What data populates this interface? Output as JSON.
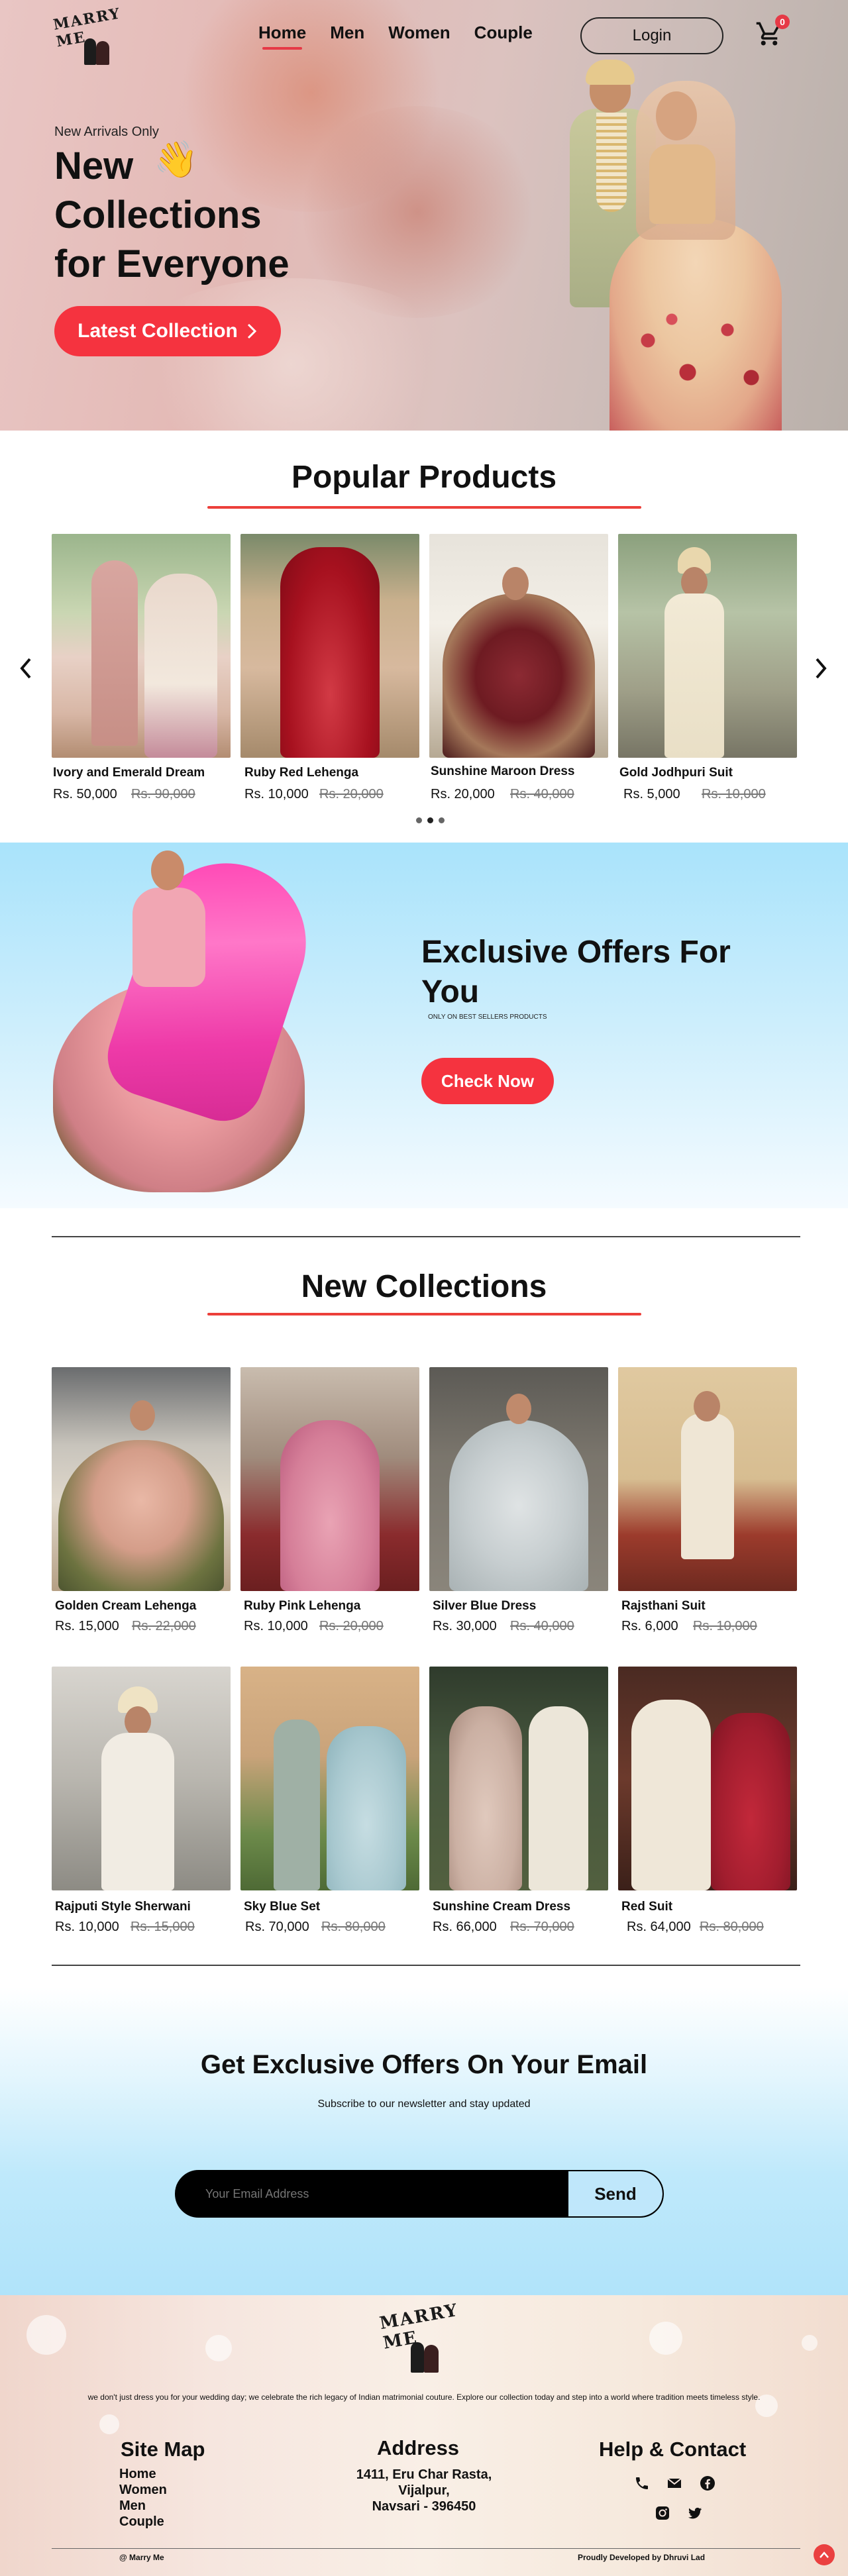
{
  "brand": {
    "logo_text": "MARRY ME"
  },
  "nav": {
    "items": [
      {
        "label": "Home",
        "active": true
      },
      {
        "label": "Men",
        "active": false
      },
      {
        "label": "Women",
        "active": false
      },
      {
        "label": "Couple",
        "active": false
      }
    ],
    "login_label": "Login",
    "cart_count": "0",
    "cart_icon": "cart-icon"
  },
  "hero": {
    "kicker": "New Arrivals Only",
    "title_line1": "New",
    "title_line2": "Collections",
    "title_line3": "for Everyone",
    "wave_icon": "👋",
    "cta_label": "Latest Collection",
    "cta_icon": "chevron-right-icon"
  },
  "popular": {
    "title": "Popular Products",
    "items": [
      {
        "name": "Ivory and Emerald Dream",
        "price": "Rs. 50,000",
        "old_price": "Rs. 90,000"
      },
      {
        "name": "Ruby Red Lehenga",
        "price": "Rs. 10,000",
        "old_price": "Rs. 20,000"
      },
      {
        "name": "Sunshine Maroon Dress",
        "price": "Rs. 20,000",
        "old_price": "Rs. 40,000"
      },
      {
        "name": "Gold Jodhpuri Suit",
        "price": "Rs. 5,000",
        "old_price": "Rs. 10,000"
      }
    ],
    "prev_icon": "chevron-left-icon",
    "next_icon": "chevron-right-icon",
    "dots": 3,
    "active_dot": 2
  },
  "offers": {
    "title": "Exclusive Offers For You",
    "subtitle": "ONLY ON BEST SELLERS PRODUCTS",
    "cta_label": "Check Now"
  },
  "new_collections": {
    "title": "New Collections",
    "items": [
      {
        "name": "Golden Cream Lehenga",
        "price": "Rs. 15,000",
        "old_price": "Rs. 22,000"
      },
      {
        "name": "Ruby Pink Lehenga",
        "price": "Rs. 10,000",
        "old_price": "Rs. 20,000"
      },
      {
        "name": "Silver Blue Dress",
        "price": "Rs. 30,000",
        "old_price": "Rs. 40,000"
      },
      {
        "name": "Rajsthani Suit",
        "price": "Rs. 6,000",
        "old_price": "Rs. 10,000"
      },
      {
        "name": "Rajputi Style Sherwani",
        "price": "Rs. 10,000",
        "old_price": "Rs. 15,000"
      },
      {
        "name": "Sky Blue Set",
        "price": "Rs. 70,000",
        "old_price": "Rs. 80,000"
      },
      {
        "name": "Sunshine Cream Dress",
        "price": "Rs. 66,000",
        "old_price": "Rs. 70,000"
      },
      {
        "name": "Red Suit",
        "price": "Rs. 64,000",
        "old_price": "Rs. 80,000"
      }
    ]
  },
  "newsletter": {
    "title": "Get Exclusive Offers On Your Email",
    "subtitle": "Subscribe to our newsletter and stay updated",
    "placeholder": "Your Email Address",
    "button_label": "Send"
  },
  "footer": {
    "about": "we don't just dress you for your wedding day; we celebrate the rich legacy of Indian matrimonial couture. Explore our collection today and step into a world where tradition meets timeless style.",
    "sitemap_title": "Site Map",
    "sitemap_links": [
      "Home",
      "Women",
      "Men",
      "Couple"
    ],
    "address_title": "Address",
    "address_lines": [
      "1411, Eru Char Rasta,",
      "Vijalpur,",
      "Navsari - 396450"
    ],
    "help_title": "Help & Contact",
    "social_icons": [
      "phone-icon",
      "mail-icon",
      "facebook-icon",
      "instagram-icon",
      "twitter-icon"
    ],
    "copyright": "@ Marry Me",
    "credit": "Proudly Developed by Dhruvi Lad",
    "top_icon": "chevron-up-icon"
  },
  "colors": {
    "accent": "#f5333f",
    "underline": "#ec3f3a",
    "offers_bg": "#a9e3fb",
    "footer_bg": "#f6e6df"
  }
}
